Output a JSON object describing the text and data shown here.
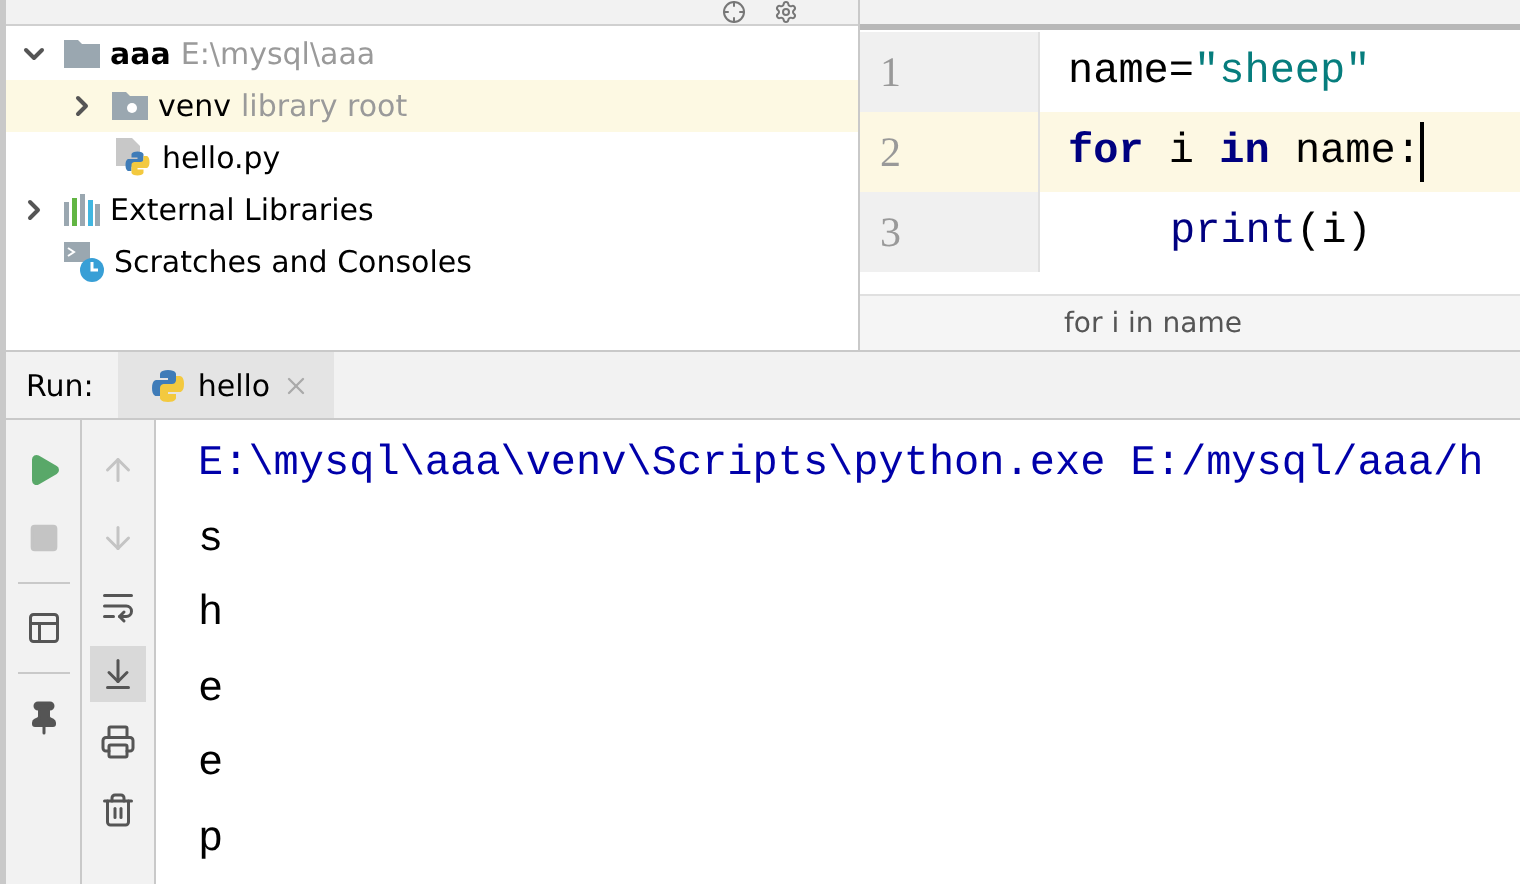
{
  "project_tree": [
    {
      "label": "aaa",
      "kind": "module",
      "hint": "E:\\mysql\\aaa",
      "expanded": true,
      "selected": false,
      "children": [
        {
          "label": "venv",
          "kind": "lib-folder",
          "hint": "library root",
          "expanded": false,
          "selected": true
        },
        {
          "label": "hello.py",
          "kind": "python-file",
          "selected": false
        }
      ]
    },
    {
      "label": "External Libraries",
      "kind": "libraries",
      "expanded": false,
      "selected": false
    },
    {
      "label": "Scratches and Consoles",
      "kind": "scratches",
      "selected": false
    }
  ],
  "editor": {
    "lines": [
      {
        "number": "1",
        "current": false,
        "tokens": [
          {
            "text": "name=",
            "kind": "plain"
          },
          {
            "text": "\"sheep\"",
            "kind": "string"
          }
        ]
      },
      {
        "number": "2",
        "current": true,
        "tokens": [
          {
            "text": "for",
            "kind": "keyword"
          },
          {
            "text": " i ",
            "kind": "plain"
          },
          {
            "text": "in",
            "kind": "keyword"
          },
          {
            "text": " name:",
            "kind": "plain"
          }
        ]
      },
      {
        "number": "3",
        "current": false,
        "indented": true,
        "tokens": [
          {
            "text": "print",
            "kind": "builtin"
          },
          {
            "text": "(i)",
            "kind": "plain"
          }
        ]
      }
    ],
    "breadcrumb": "for i in name"
  },
  "run_panel": {
    "label": "Run:",
    "tab": "hello",
    "scroll_to_end_on": true,
    "console": [
      {
        "text": "E:\\mysql\\aaa\\venv\\Scripts\\python.exe E:/mysql/aaa/h",
        "kind": "command"
      },
      {
        "text": "s",
        "kind": "output"
      },
      {
        "text": "h",
        "kind": "output"
      },
      {
        "text": "e",
        "kind": "output"
      },
      {
        "text": "e",
        "kind": "output"
      },
      {
        "text": "p",
        "kind": "output"
      }
    ]
  }
}
